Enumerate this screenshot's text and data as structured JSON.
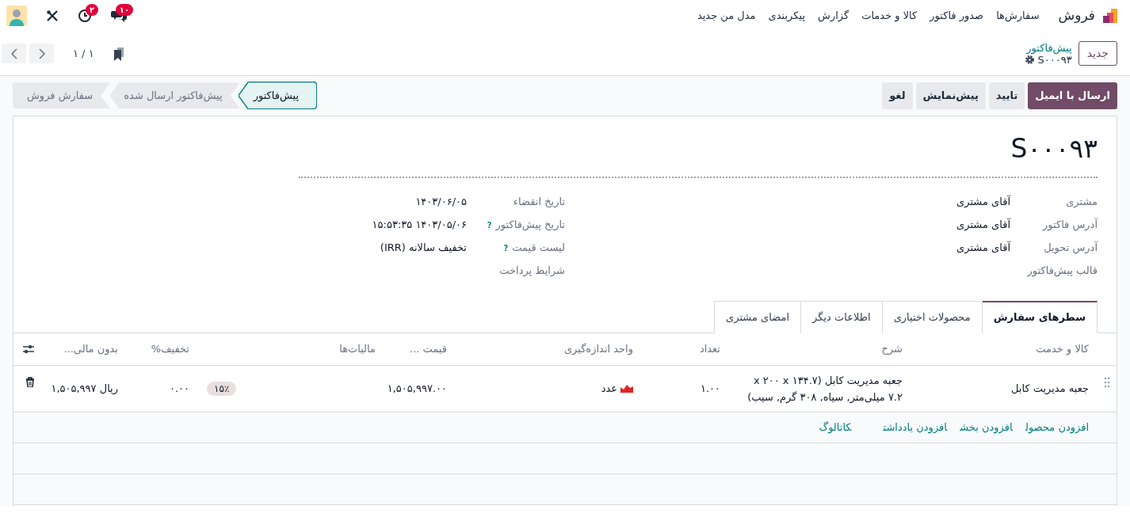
{
  "navbar": {
    "app": "فروش",
    "menu": [
      "سفارش‌ها",
      "صدور فاکتور",
      "کالا و خدمات",
      "گزارش",
      "پیکربندی",
      "مدل من جدید"
    ],
    "message_count": "۱۰",
    "activity_count": "۲"
  },
  "control_panel": {
    "new_button": "جدید",
    "breadcrumb": "پیش‌فاکتور",
    "record": "S۰۰۰۹۳",
    "pager": "۱ / ۱"
  },
  "actions": [
    {
      "label": "ارسال با ایمیل",
      "primary": true
    },
    {
      "label": "تایید",
      "primary": false
    },
    {
      "label": "پیش‌نمایش",
      "primary": false
    },
    {
      "label": "لغو",
      "primary": false
    }
  ],
  "statuses": [
    {
      "label": "پیش‌فاکتور",
      "selected": true
    },
    {
      "label": "پیش‌فاکتور ارسال شده",
      "selected": false
    },
    {
      "label": "سفارش فروش",
      "selected": false
    }
  ],
  "form": {
    "title": "S۰۰۰۹۳",
    "right_fields": [
      {
        "label": "مشتری",
        "value": "آقای مشتری"
      },
      {
        "label": "آدرس فاکتور",
        "value": "آقای مشتری"
      },
      {
        "label": "آدرس تحویل",
        "value": "آقای مشتری"
      },
      {
        "label": "قالب پیش‌فاکتور"
      }
    ],
    "left_fields": [
      {
        "label": "تاریخ انقضاء",
        "value": "۱۴۰۳/۰۶/۰۵"
      },
      {
        "label": "تاریخ پیش‌فاکتور",
        "help": "?",
        "value": "۱۴۰۳/۰۵/۰۶ ۱۵:۵۳:۳۵"
      },
      {
        "label": "لیست قیمت",
        "help": "?",
        "value": "تخفیف سالانه (IRR)"
      },
      {
        "label": "شرایط پرداخت"
      }
    ]
  },
  "tabs": [
    {
      "label": "سطرهای سفارش",
      "selected": true
    },
    {
      "label": "محصولات اختیاری",
      "selected": false
    },
    {
      "label": "اطلاعات دیگر",
      "selected": false
    },
    {
      "label": "امضای مشتری",
      "selected": false
    }
  ],
  "table": {
    "columns": [
      "کالا و خدمت",
      "شرح",
      "تعداد",
      "واحد اندازه‌گیری",
      "قیمت ...",
      "مالیات‌ها",
      "تخفیف%",
      "بدون مالی..."
    ],
    "rows": [
      {
        "product": "جعبه مدیریت کابل",
        "description": "جعبه مدیریت کابل (۱۳۴.۷ x ۲۰۰ x ۷.۲ میلی‌متر, سیاه, ۳۰۸ گرم, سیب)",
        "quantity": "۱.۰۰",
        "uom": "عدد",
        "unit_price": "۱,۵۰۵,۹۹۷.۰۰",
        "taxes": "۱۵٪",
        "discount": "۰.۰۰",
        "subtotal": "ریال ۱,۵۰۵,۹۹۷"
      }
    ],
    "add_links": [
      "افزودن محصول",
      "افزودن بخش",
      "افزودن یادداشت",
      "کاتالوگ"
    ]
  }
}
